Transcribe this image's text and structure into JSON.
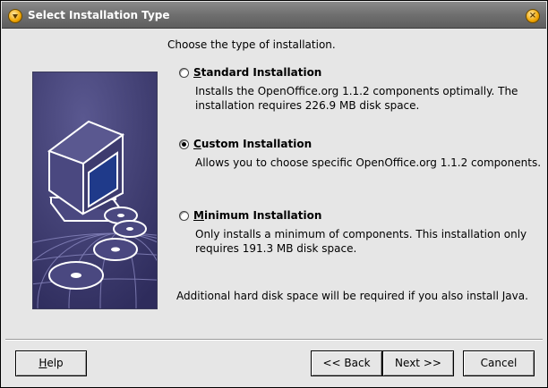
{
  "window": {
    "title": "Select Installation Type",
    "close_glyph": "×"
  },
  "main": {
    "heading": "Choose the type of installation.",
    "options": [
      {
        "mnemonic": "S",
        "label_rest": "tandard Installation",
        "description_line1": "Installs the OpenOffice.org 1.1.2 components optimally. The",
        "description_line2": "installation requires 226.9 MB disk space.",
        "selected": false
      },
      {
        "mnemonic": "C",
        "label_rest": "ustom Installation",
        "description_line1": "Allows you to choose specific OpenOffice.org 1.1.2 components.",
        "description_line2": "",
        "selected": true
      },
      {
        "mnemonic": "M",
        "label_rest": "inimum Installation",
        "description_line1": "Only installs a minimum of components. This installation only",
        "description_line2": "requires 191.3 MB disk space.",
        "selected": false
      }
    ],
    "footnote": "Additional hard disk space will be required if you also install Java."
  },
  "buttons": {
    "help_mnemonic": "H",
    "help_rest": "elp",
    "back": "<< Back",
    "next": "Next >>",
    "cancel": "Cancel"
  },
  "colors": {
    "title_bar": "#6f6f6f",
    "dialog_bg": "#e6e6e6",
    "banner_bg": "#3d3b6e"
  },
  "icons": {
    "title": "openoffice-logo-icon",
    "close": "close-icon",
    "banner": "computer-with-discs-illustration"
  }
}
